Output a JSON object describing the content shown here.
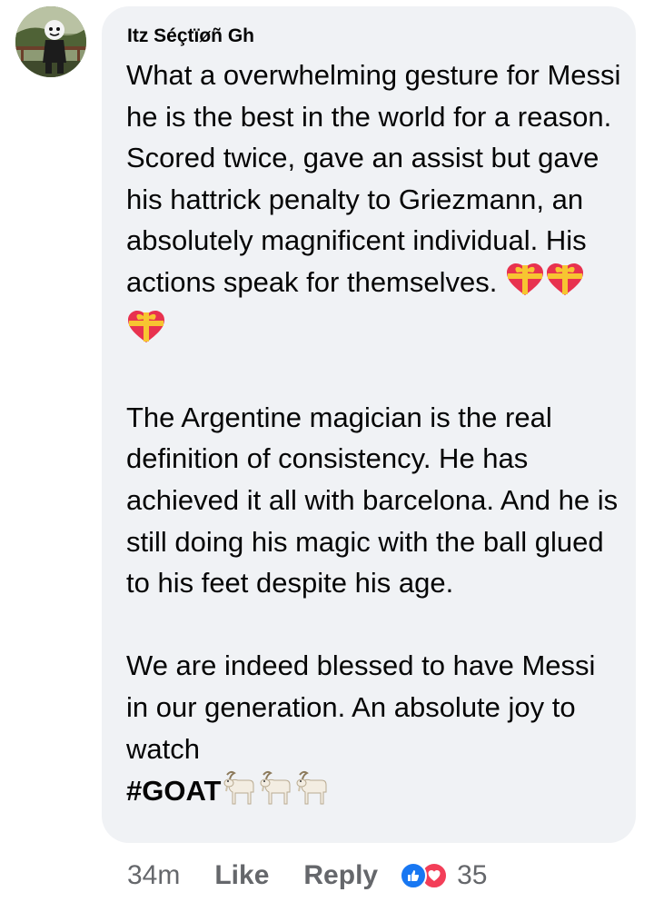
{
  "comment": {
    "author": "Itz Séçtïøñ Gh",
    "paragraphs": [
      {
        "text": "What a overwhelming gesture for Messi he is the best in the world for a reason. Scored twice, gave an assist but gave his hattrick penalty to Griezmann, an absolutely magnificent individual. His actions speak for themselves. ",
        "emoji": [
          "gift-heart",
          "gift-heart",
          "gift-heart"
        ]
      },
      {
        "text": "The Argentine magician is the real definition of consistency. He has achieved it all with barcelona. And he is still doing his magic with the ball glued to his feet despite his age."
      },
      {
        "text": "We are indeed blessed to have Messi in our generation. An absolute joy to watch"
      }
    ],
    "hashtag": "#GOAT",
    "hashtag_emoji": [
      "goat",
      "goat",
      "goat"
    ]
  },
  "meta": {
    "time": "34m",
    "like_label": "Like",
    "reply_label": "Reply",
    "reaction_icons": [
      "like-icon",
      "love-icon"
    ],
    "reaction_count": "35"
  },
  "colors": {
    "bubble": "#f0f2f5",
    "text": "#050505",
    "meta": "#65676b",
    "like_blue": "#1877f2",
    "love_red": "#f33e58"
  }
}
